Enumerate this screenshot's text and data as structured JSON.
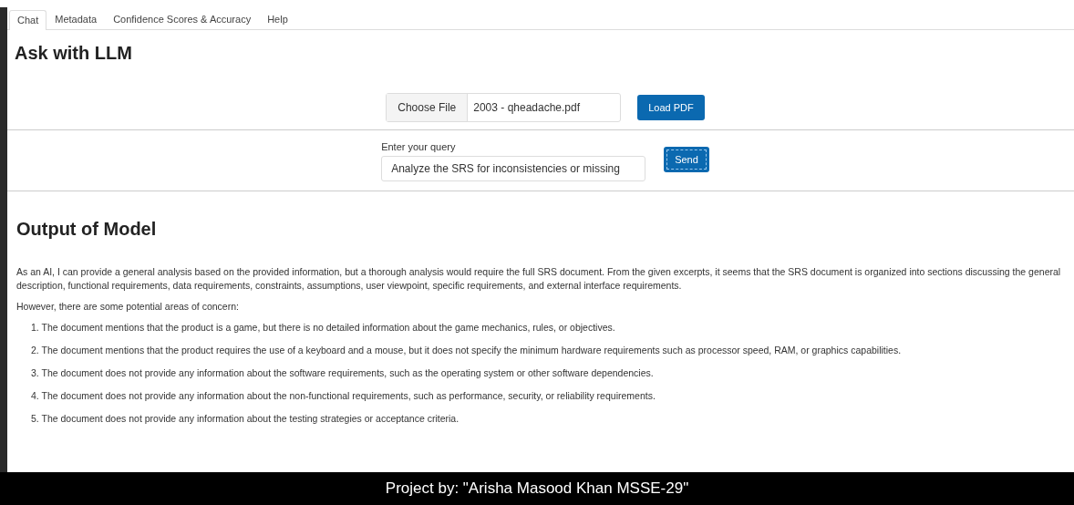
{
  "tabs": [
    {
      "label": "Chat",
      "selected": true
    },
    {
      "label": "Metadata",
      "selected": false
    },
    {
      "label": "Confidence Scores & Accuracy",
      "selected": false
    },
    {
      "label": "Help",
      "selected": false
    }
  ],
  "title": "Ask with LLM",
  "file_picker": {
    "button": "Choose File",
    "file_name": "2003 - qheadache.pdf"
  },
  "load_button": "Load PDF",
  "query": {
    "label": "Enter your query",
    "value": "Analyze the SRS for inconsistencies or missing"
  },
  "send_button": "Send",
  "output": {
    "heading": "Output of Model",
    "paragraphs": [
      "As an AI, I can provide a general analysis based on the provided information, but a thorough analysis would require the full SRS document. From the given excerpts, it seems that the SRS document is organized into sections discussing the general description, functional requirements, data requirements, constraints, assumptions, user viewpoint, specific requirements, and external interface requirements.",
      "However, there are some potential areas of concern:"
    ],
    "items": [
      "1. The document mentions that the product is a game, but there is no detailed information about the game mechanics, rules, or objectives.",
      "2. The document mentions that the product requires the use of a keyboard and a mouse, but it does not specify the minimum hardware requirements such as processor speed, RAM, or graphics capabilities.",
      "3. The document does not provide any information about the software requirements, such as the operating system or other software dependencies.",
      "4. The document does not provide any information about the non-functional requirements, such as performance, security, or reliability requirements.",
      "5. The document does not provide any information about the testing strategies or acceptance criteria."
    ]
  },
  "footer": "Project by: \"Arisha Masood Khan MSSE-29\""
}
